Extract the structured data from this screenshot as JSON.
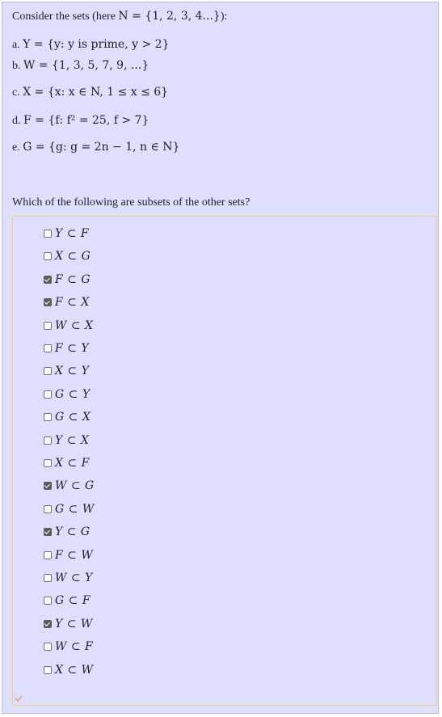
{
  "intro": {
    "prefix": "Consider the sets (here ",
    "math": "N = {1, 2, 3, 4...}",
    "suffix": "):"
  },
  "items": [
    {
      "prefix": "a. ",
      "math": "Y = {y: y is prime, y > 2}"
    },
    {
      "prefix": "b. ",
      "math": "W = {1, 3, 5, 7, 9, ...}"
    },
    {
      "prefix": "c. ",
      "math": "X = {x: x ∈ N, 1 ≤ x ≤ 6}"
    },
    {
      "prefix": "d. ",
      "math": "F = {f: f² = 25, f > 7}"
    },
    {
      "prefix": "e. ",
      "math": "G = {g: g = 2n − 1, n ∈ N}"
    }
  ],
  "question": "Which of the following are subsets of the other sets?",
  "options": [
    {
      "label": "Y ⊂ F",
      "checked": false
    },
    {
      "label": "X ⊂ G",
      "checked": false
    },
    {
      "label": "F ⊂ G",
      "checked": true
    },
    {
      "label": "F ⊂ X",
      "checked": true
    },
    {
      "label": "W ⊂ X",
      "checked": false
    },
    {
      "label": "F ⊂ Y",
      "checked": false
    },
    {
      "label": "X ⊂ Y",
      "checked": false
    },
    {
      "label": "G ⊂ Y",
      "checked": false
    },
    {
      "label": "G ⊂ X",
      "checked": false
    },
    {
      "label": "Y ⊂ X",
      "checked": false
    },
    {
      "label": "X ⊂ F",
      "checked": false
    },
    {
      "label": "W ⊂ G",
      "checked": true
    },
    {
      "label": "G ⊂ W",
      "checked": false
    },
    {
      "label": "Y ⊂ G",
      "checked": true
    },
    {
      "label": "F ⊂ W",
      "checked": false
    },
    {
      "label": "W ⊂ Y",
      "checked": false
    },
    {
      "label": "G ⊂ F",
      "checked": false
    },
    {
      "label": "Y ⊂ W",
      "checked": true
    },
    {
      "label": "W ⊂ F",
      "checked": false
    },
    {
      "label": "X ⊂ W",
      "checked": false
    }
  ],
  "colors": {
    "panel_bg": "#dedeff",
    "answers_border": "#f2cf7d",
    "status_icon": "#e89a63"
  },
  "status_icon": "partial-check-icon"
}
